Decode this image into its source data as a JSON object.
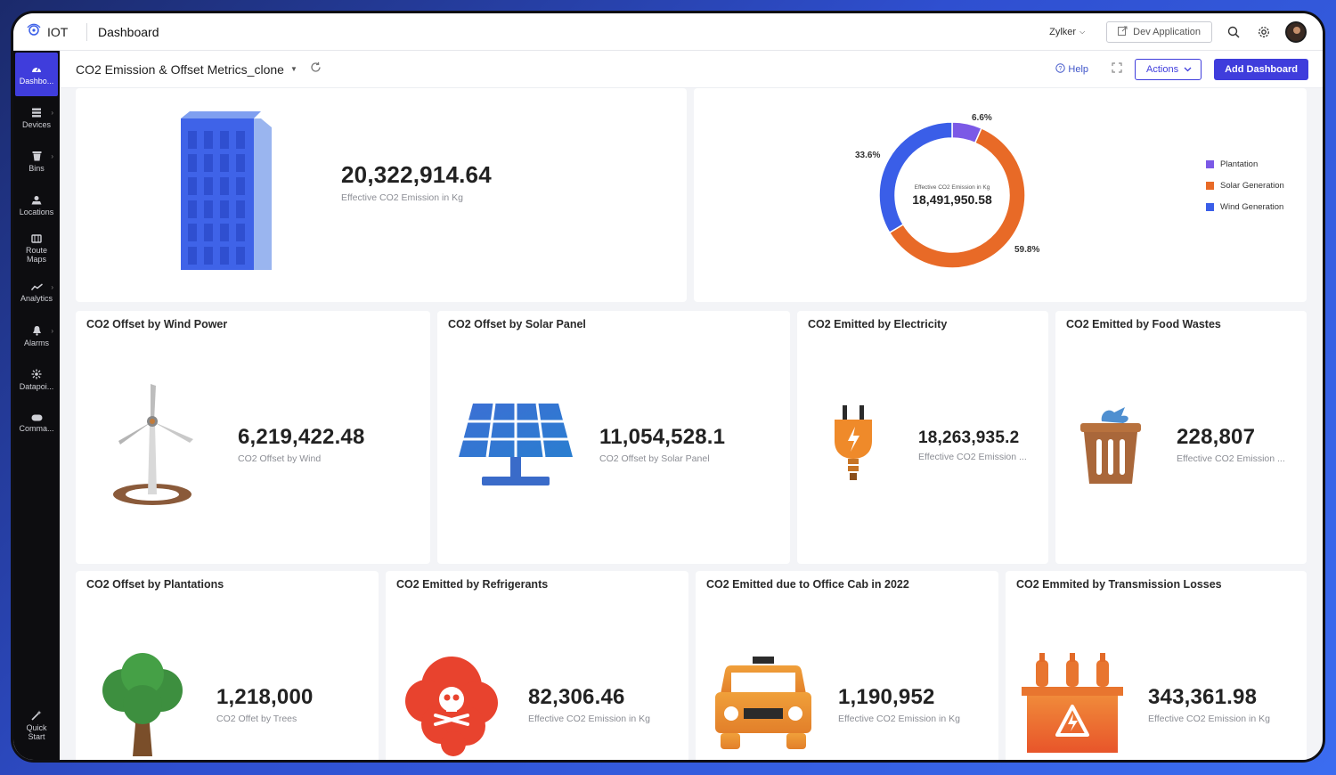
{
  "app": {
    "brand": "IOT",
    "title": "Dashboard",
    "org": "Zylker",
    "dev_button": "Dev Application"
  },
  "sidebar": {
    "items": [
      {
        "label": "Dashbo...",
        "icon": "dashboard-icon"
      },
      {
        "label": "Devices",
        "icon": "devices-icon"
      },
      {
        "label": "Bins",
        "icon": "bin-icon"
      },
      {
        "label": "Locations",
        "icon": "location-icon"
      },
      {
        "label": "Route Maps",
        "icon": "route-map-icon"
      },
      {
        "label": "Analytics",
        "icon": "analytics-icon"
      },
      {
        "label": "Alarms",
        "icon": "alarm-icon"
      },
      {
        "label": "Datapoi...",
        "icon": "datapoint-icon"
      },
      {
        "label": "Comma...",
        "icon": "command-icon"
      }
    ],
    "quick_start": "Quick Start"
  },
  "subbar": {
    "dashboard_name": "CO2 Emission & Offset Metrics_clone",
    "help": "Help",
    "actions": "Actions",
    "add_dashboard": "Add Dashboard"
  },
  "top_cards": {
    "emission": {
      "value": "20,322,914.64",
      "label": "Effective CO2 Emission in Kg"
    },
    "donut": {
      "center_label": "Effective CO2 Emission in Kg",
      "center_value": "18,491,950.58",
      "legend": [
        "Plantation",
        "Solar Generation",
        "Wind Generation"
      ]
    }
  },
  "chart_data": {
    "type": "pie",
    "categories": [
      "Plantation",
      "Solar Generation",
      "Wind Generation"
    ],
    "values": [
      6.6,
      59.8,
      33.6
    ],
    "labels": [
      "6.6%",
      "59.8%",
      "33.6%"
    ],
    "colors": [
      "#7b59e6",
      "#e86a27",
      "#3a5ee8"
    ],
    "legend_position": "right"
  },
  "cards_row2": [
    {
      "title": "CO2 Offset by Wind Power",
      "value": "6,219,422.48",
      "label": "CO2 Offset by Wind"
    },
    {
      "title": "CO2 Offset by Solar Panel",
      "value": "11,054,528.1",
      "label": "CO2 Offset by Solar Panel"
    },
    {
      "title": "CO2 Emitted by Electricity",
      "value": "18,263,935.2",
      "label": "Effective CO2 Emission ..."
    },
    {
      "title": "CO2 Emitted by Food Wastes",
      "value": "228,807",
      "label": "Effective CO2 Emission ..."
    }
  ],
  "cards_row3": [
    {
      "title": "CO2 Offset by Plantations",
      "value": "1,218,000",
      "label": "CO2 Offet by Trees"
    },
    {
      "title": "CO2 Emitted by Refrigerants",
      "value": "82,306.46",
      "label": "Effective CO2 Emission in Kg"
    },
    {
      "title": "CO2 Emitted due to Office Cab in 2022",
      "value": "1,190,952",
      "label": "Effective CO2 Emission in Kg"
    },
    {
      "title": "CO2 Emmited by Transmission Losses",
      "value": "343,361.98",
      "label": "Effective CO2 Emission in Kg"
    }
  ]
}
